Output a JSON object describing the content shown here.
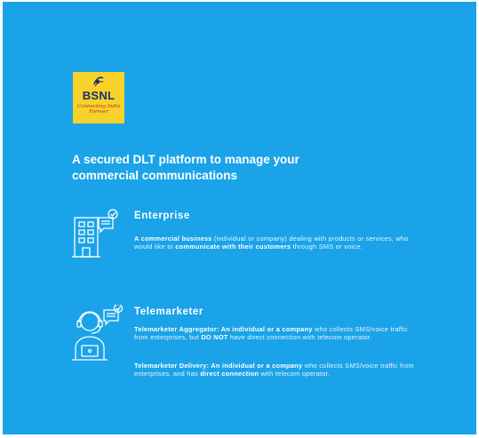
{
  "logo": {
    "brand": "BSNL",
    "tagline": "Connecting India Forever"
  },
  "headline": {
    "line1": "A secured DLT platform to manage your",
    "line2": "commercial communications"
  },
  "enterprise": {
    "icon": "office-building-chat-icon",
    "title": "Enterprise",
    "p_bold1": "A commercial business",
    "p_text1": " (individual or company) dealing with products or services, who would like to ",
    "p_bold2": "communicate with their customers",
    "p_text2": " through SMS or voice."
  },
  "telemarketer": {
    "icon": "call-agent-headset-icon",
    "title": "Telemarketer",
    "agg_bold1": "Telemarketer Aggregator: An individual or a company",
    "agg_text1": " who collects SMS/voice traffic from enterprises, but ",
    "agg_bold2": "DO NOT",
    "agg_text2": " have direct connection with telecom operator.",
    "del_bold1": "Telemarketer Delivery: An individual or a company",
    "del_text1": " who collects SMS/voice traffic from enterprises, and has ",
    "del_bold2": "direct connection",
    "del_text2": " with telecom operator."
  },
  "colors": {
    "background": "#1aa3e8",
    "logo_bg": "#f6d32a",
    "logo_text": "#1a2f7a",
    "tagline": "#c0282d"
  }
}
